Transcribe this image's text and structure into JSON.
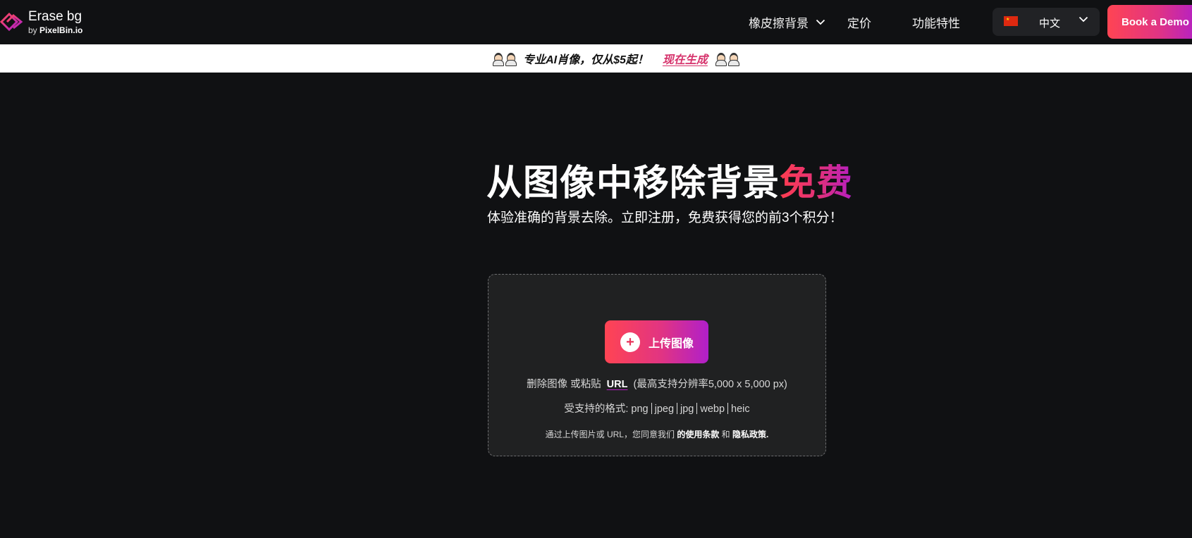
{
  "header": {
    "logo": {
      "name": "Erase bg",
      "by_prefix": "by",
      "by_brand": "PixelBin.io"
    },
    "nav": {
      "erase_label": "橡皮擦背景",
      "pricing_label": "定价",
      "features_label": "功能特性"
    },
    "language": {
      "selected": "中文",
      "flag": "china-flag"
    },
    "demo_label": "Book a Demo",
    "colors": {
      "background": "#101113",
      "accent_start": "#ff4453",
      "accent_end": "#b21fc9"
    }
  },
  "promo": {
    "text": "专业AI肖像，仅从$5起！",
    "link": "现在生成",
    "emoji": "woman-technologist"
  },
  "hero": {
    "title_main": "从图像中移除背景",
    "title_accent": "免费",
    "subtitle": "体验准确的背景去除。立即注册，免费获得您的前3个积分！"
  },
  "upload": {
    "button_label": "上传图像",
    "hint_prefix": "删除图像 或粘贴",
    "url_label": "URL",
    "hint_suffix": "(最高支持分辨率5,000 x 5,000 px)",
    "formats_label": "受支持的格式:",
    "formats": [
      "png",
      "jpeg",
      "jpg",
      "webp",
      "heic"
    ],
    "terms_prefix": "通过上传图片或 URL，您同意我们",
    "terms_link": "的使用条款",
    "and": "和",
    "privacy_link": "隐私政策."
  }
}
